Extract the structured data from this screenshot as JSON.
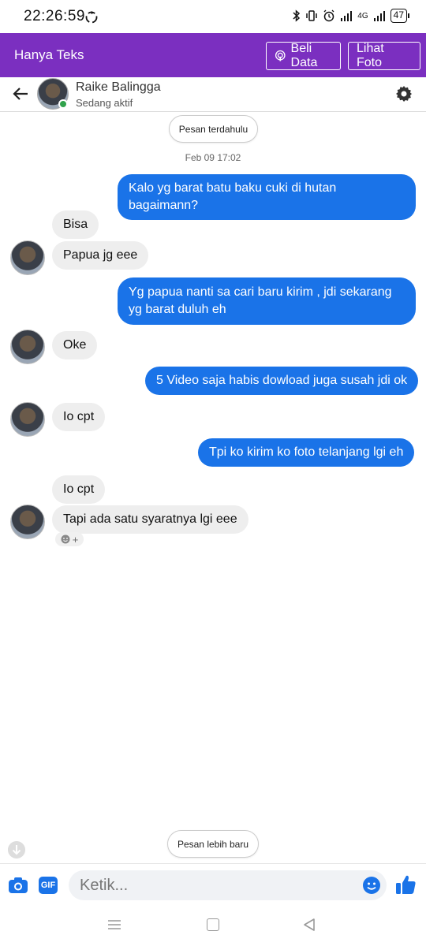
{
  "status_bar": {
    "time": "22:26:59",
    "network": "4G",
    "battery": "47"
  },
  "topbar": {
    "title": "Hanya Teks",
    "buy_data_label": "Beli Data",
    "view_photo_label": "Lihat Foto",
    "accent": "#7b2fc0"
  },
  "contact": {
    "name": "Raike Balingga",
    "status": "Sedang aktif"
  },
  "chat": {
    "older_label": "Pesan terdahulu",
    "newer_label": "Pesan lebih baru",
    "timestamp": "Feb 09 17:02",
    "messages": [
      {
        "dir": "out",
        "text": "Kalo yg barat batu baku cuki di hutan bagaimann?"
      },
      {
        "dir": "in",
        "text": "Bisa"
      },
      {
        "dir": "in",
        "text": "Papua jg eee"
      },
      {
        "dir": "out",
        "text": "Yg papua nanti sa cari baru kirim , jdi sekarang  yg barat duluh eh"
      },
      {
        "dir": "in",
        "text": "Oke"
      },
      {
        "dir": "out",
        "text": "5 Video saja habis dowload juga susah jdi ok"
      },
      {
        "dir": "in",
        "text": "Io cpt"
      },
      {
        "dir": "out",
        "text": "Tpi ko kirim ko foto telanjang lgi eh"
      },
      {
        "dir": "in",
        "text": "Io cpt"
      },
      {
        "dir": "in",
        "text": "Tapi ada satu syaratnya lgi eee"
      }
    ],
    "outgoing_color": "#1a73e8",
    "incoming_color": "#eeeeee"
  },
  "composer": {
    "placeholder": "Ketik...",
    "gif_label": "GIF"
  }
}
